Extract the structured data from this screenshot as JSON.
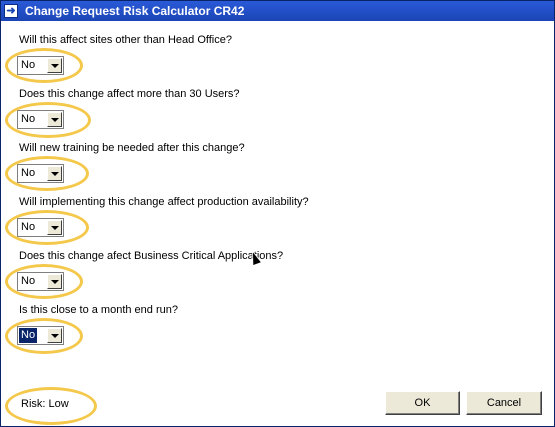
{
  "window": {
    "title": "Change Request Risk Calculator CR42",
    "icon": "arrow-right-icon"
  },
  "questions": [
    {
      "label": "Will this affect sites other than Head Office?",
      "answer": "No",
      "selected": false
    },
    {
      "label": "Does this change affect more than 30 Users?",
      "answer": "No",
      "selected": false
    },
    {
      "label": "Will new training be needed after this change?",
      "answer": "No",
      "selected": false
    },
    {
      "label": "Will implementing this change affect production availability?",
      "answer": "No",
      "selected": false
    },
    {
      "label": "Does this change afect Business Critical Applications?",
      "answer": "No",
      "selected": false
    },
    {
      "label": "Is this close to a month end run?",
      "answer": "No",
      "selected": true
    }
  ],
  "risk": {
    "text": "Risk: Low"
  },
  "buttons": {
    "ok": "OK",
    "cancel": "Cancel"
  },
  "colors": {
    "highlight": "#f4c84b",
    "titlebar": "#1c45b6",
    "selection": "#0a246a"
  }
}
